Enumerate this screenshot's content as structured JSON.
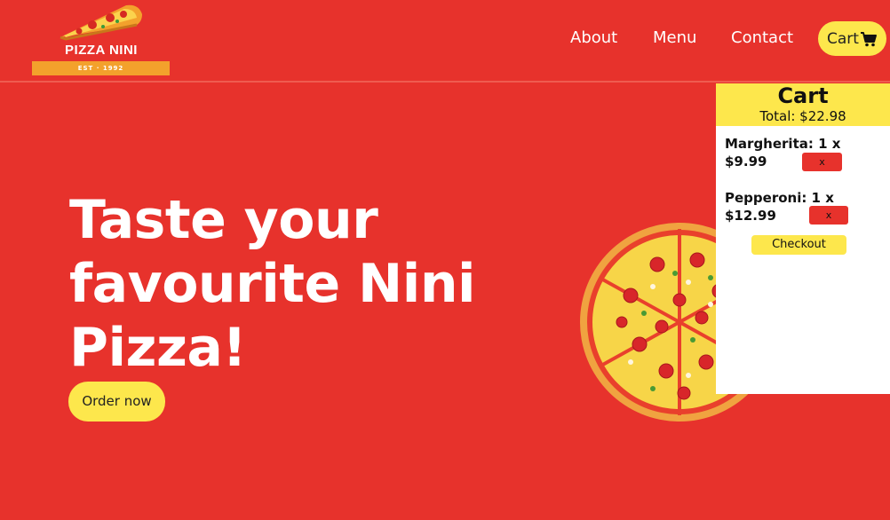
{
  "logo": {
    "name": "PIZZA NINI",
    "est": "EST · 1992"
  },
  "nav": {
    "about": "About",
    "menu": "Menu",
    "contact": "Contact",
    "cart": "Cart"
  },
  "hero": {
    "title_line1": "Taste your",
    "title_line2": "favourite Nini",
    "title_line3": "Pizza!",
    "order_button": "Order now"
  },
  "cart_panel": {
    "title": "Cart",
    "total": "Total: $22.98",
    "items": [
      {
        "name_qty": "Margherita: 1 x",
        "price": "$9.99",
        "remove_label": "x"
      },
      {
        "name_qty": "Pepperoni: 1 x",
        "price": "$12.99",
        "remove_label": "x"
      }
    ],
    "checkout": "Checkout"
  },
  "colors": {
    "background": "#e7322c",
    "accent": "#fde74c",
    "band": "#f3a12c"
  },
  "icons": [
    "pizza-slice-logo",
    "cart-icon",
    "pizza-image"
  ]
}
